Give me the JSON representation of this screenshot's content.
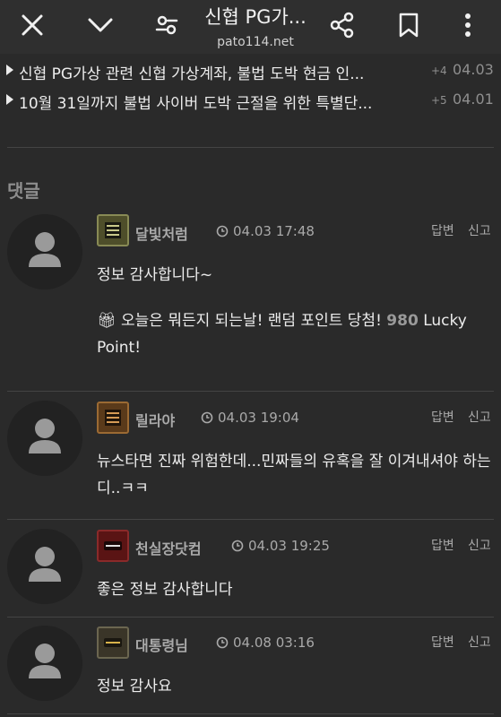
{
  "header": {
    "title": "신협 PG가...",
    "url": "pato114.net"
  },
  "related": [
    {
      "title": "신협 PG가상 관련 신협 가상계좌, 불법 도박 현금 인...",
      "count": "+4",
      "date": "04.03"
    },
    {
      "title": "10월 31일까지 불법 사이버 도박 근절을 위한 특별단...",
      "count": "+5",
      "date": "04.01"
    }
  ],
  "comments_title": "댓글",
  "comments": [
    {
      "nick": "달빛처럼",
      "time": "04.03 17:48",
      "reply": "답변",
      "report": "신고",
      "body": "정보 감사합니다~",
      "extra_prefix": "오늘은 뭐든지 되는날! 랜덤 포인트 당첨!",
      "extra_points": "980",
      "extra_suffix": "Lucky Point!"
    },
    {
      "nick": "릴라야",
      "time": "04.03 19:04",
      "reply": "답변",
      "report": "신고",
      "body": "뉴스타면 진짜 위험한데...민짜들의 유혹을 잘 이겨내셔야 하는디..ㅋㅋ"
    },
    {
      "nick": "천실장닷컴",
      "time": "04.03 19:25",
      "reply": "답변",
      "report": "신고",
      "body": "좋은 정보 감사합니다"
    },
    {
      "nick": "대통령님",
      "time": "04.08 03:16",
      "reply": "답변",
      "report": "신고",
      "body": "정보 감사요"
    }
  ],
  "icons": {
    "close": "close-icon",
    "collapse": "chevron-down-icon",
    "settings": "tune-icon",
    "share": "share-icon",
    "bookmark": "bookmark-icon",
    "more": "more-vertical-icon"
  }
}
